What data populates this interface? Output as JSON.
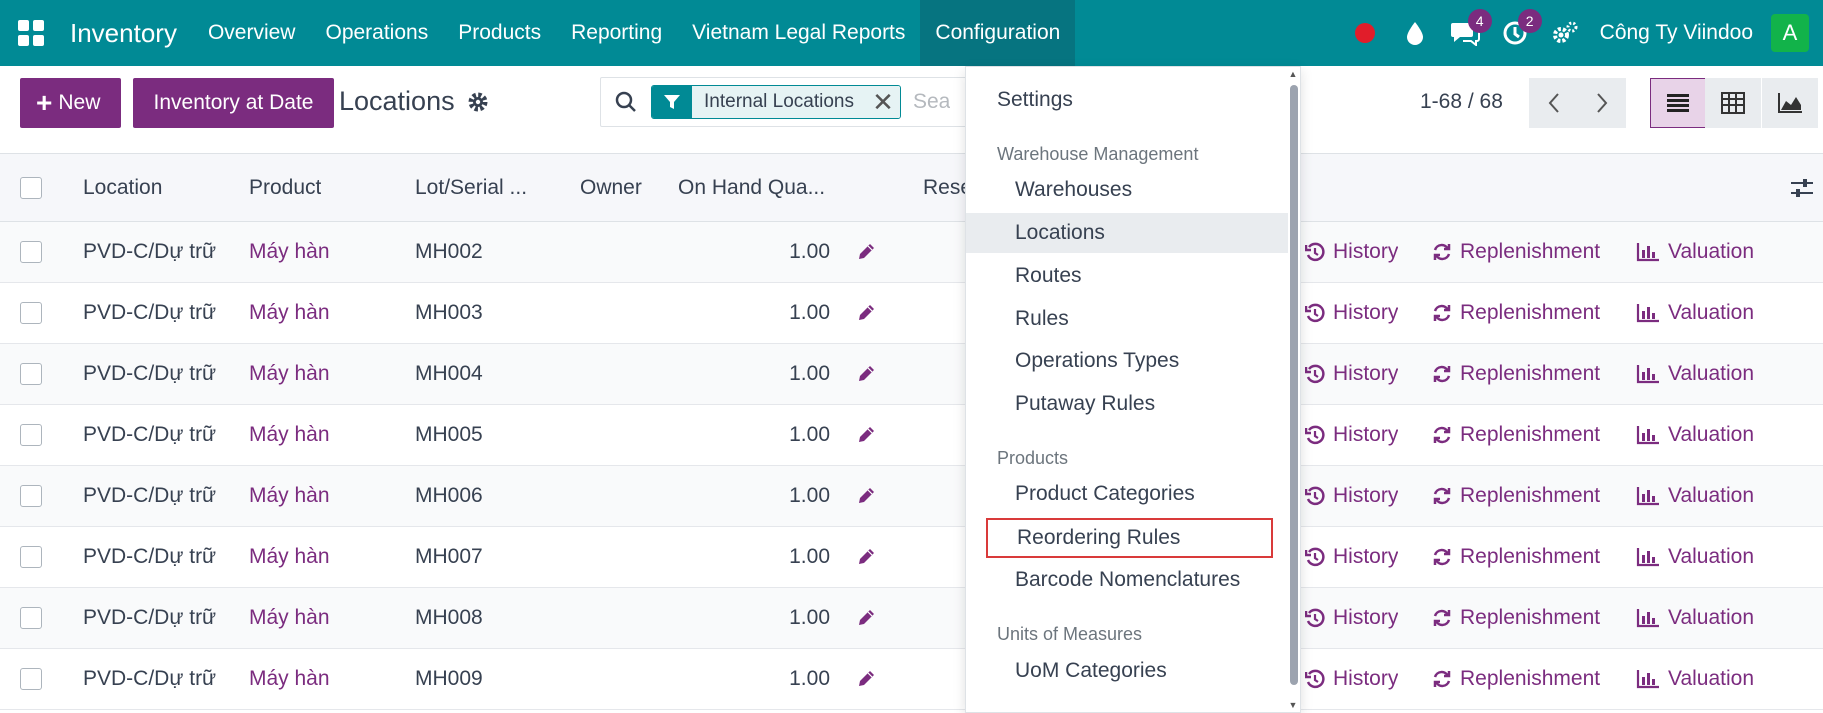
{
  "topbar": {
    "brand": "Inventory",
    "menu": [
      "Overview",
      "Operations",
      "Products",
      "Reporting",
      "Vietnam Legal Reports",
      "Configuration"
    ],
    "active_menu": "Configuration",
    "chat_badge": "4",
    "activity_badge": "2",
    "company": "Công Ty Viindoo",
    "avatar_letter": "A",
    "accent": "#018a95"
  },
  "control": {
    "new_label": "New",
    "inventory_at_date_label": "Inventory at Date",
    "page_title": "Locations",
    "filter_facet": "Internal Locations",
    "search_placeholder": "Sea",
    "pager": "1-68 / 68"
  },
  "list": {
    "columns": [
      "Location",
      "Product",
      "Lot/Serial ...",
      "Owner",
      "On Hand Qua...",
      "Rese"
    ],
    "rows": [
      {
        "location": "PVD-C/Dự trữ",
        "product": "Máy hàn",
        "lot": "MH002",
        "qty": "1.00"
      },
      {
        "location": "PVD-C/Dự trữ",
        "product": "Máy hàn",
        "lot": "MH003",
        "qty": "1.00"
      },
      {
        "location": "PVD-C/Dự trữ",
        "product": "Máy hàn",
        "lot": "MH004",
        "qty": "1.00"
      },
      {
        "location": "PVD-C/Dự trữ",
        "product": "Máy hàn",
        "lot": "MH005",
        "qty": "1.00"
      },
      {
        "location": "PVD-C/Dự trữ",
        "product": "Máy hàn",
        "lot": "MH006",
        "qty": "1.00"
      },
      {
        "location": "PVD-C/Dự trữ",
        "product": "Máy hàn",
        "lot": "MH007",
        "qty": "1.00"
      },
      {
        "location": "PVD-C/Dự trữ",
        "product": "Máy hàn",
        "lot": "MH008",
        "qty": "1.00"
      },
      {
        "location": "PVD-C/Dự trữ",
        "product": "Máy hàn",
        "lot": "MH009",
        "qty": "1.00"
      }
    ],
    "actions": {
      "history": "History",
      "replenishment": "Replenishment",
      "valuation": "Valuation"
    },
    "product_color": "#7b2c7f"
  },
  "dropdown": {
    "settings": "Settings",
    "sections": [
      {
        "header": "Warehouse Management",
        "items": [
          "Warehouses",
          "Locations",
          "Routes",
          "Rules",
          "Operations Types",
          "Putaway Rules"
        ]
      },
      {
        "header": "Products",
        "items": [
          "Product Categories",
          "Reordering Rules",
          "Barcode Nomenclatures"
        ]
      },
      {
        "header": "Units of Measures",
        "items": [
          "UoM Categories"
        ]
      }
    ],
    "selected_item": "Locations",
    "highlighted_item": "Reordering Rules"
  }
}
